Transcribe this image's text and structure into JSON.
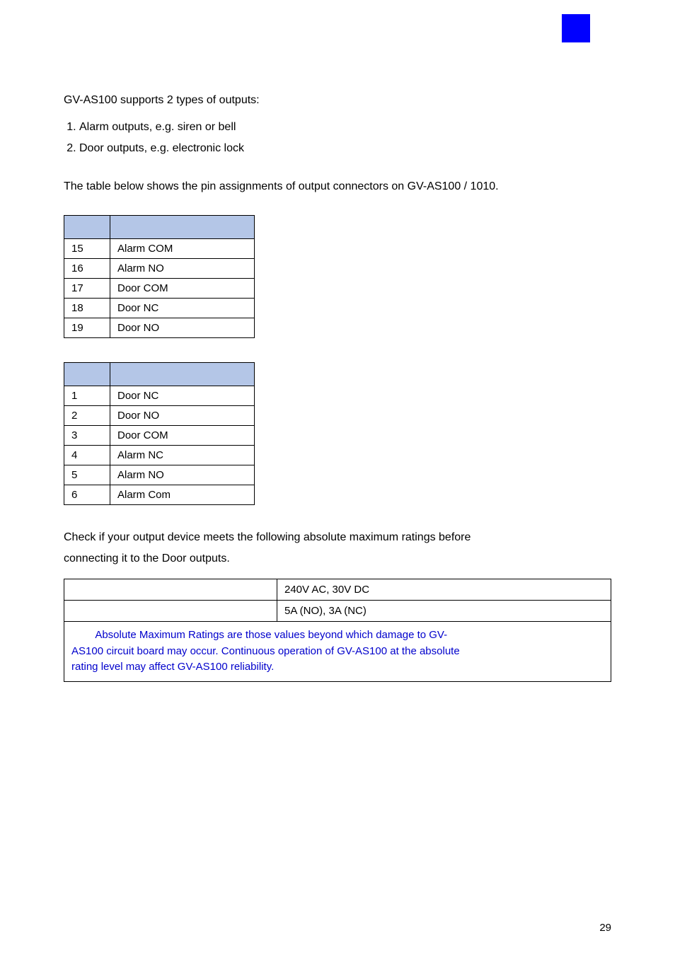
{
  "intro": "GV-AS100 supports 2 types of outputs:",
  "list": [
    "Alarm outputs, e.g. siren or bell",
    "Door outputs, e.g. electronic lock"
  ],
  "assign_para": "The table below shows the pin assignments of output connectors on GV-AS100 / 1010.",
  "table_a": [
    {
      "pin": "15",
      "fn": "Alarm COM"
    },
    {
      "pin": "16",
      "fn": "Alarm NO"
    },
    {
      "pin": "17",
      "fn": "Door COM"
    },
    {
      "pin": "18",
      "fn": "Door NC"
    },
    {
      "pin": "19",
      "fn": "Door NO"
    }
  ],
  "table_b": [
    {
      "pin": "1",
      "fn": "Door NC"
    },
    {
      "pin": "2",
      "fn": "Door NO"
    },
    {
      "pin": "3",
      "fn": "Door COM"
    },
    {
      "pin": "4",
      "fn": "Alarm NC"
    },
    {
      "pin": "5",
      "fn": "Alarm NO"
    },
    {
      "pin": "6",
      "fn": "Alarm Com"
    }
  ],
  "check_para_1": "Check if your output device meets the following absolute maximum ratings before",
  "check_para_2": "connecting it to the Door outputs.",
  "ratings": [
    {
      "label": "",
      "value": "240V AC, 30V DC"
    },
    {
      "label": "",
      "value": "5A (NO), 3A (NC)"
    }
  ],
  "note_indent": "        Absolute Maximum Ratings are those values beyond which damage to GV-",
  "note_line2": "AS100 circuit board may occur. Continuous operation of GV-AS100 at the absolute",
  "note_line3": "rating level may affect GV-AS100 reliability.",
  "page_number": "29"
}
